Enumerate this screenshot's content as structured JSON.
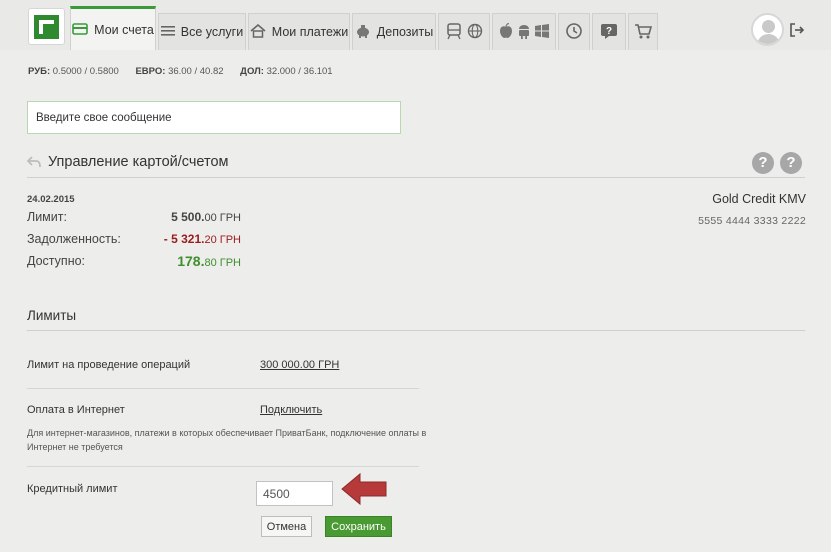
{
  "nav": {
    "tabs": [
      {
        "label": "Мои счета",
        "icon": "card-icon",
        "active": true
      },
      {
        "label": "Все услуги",
        "icon": "list-icon"
      },
      {
        "label": "Мои платежи",
        "icon": "home-icon"
      },
      {
        "label": "Депозиты",
        "icon": "piggy-bank-icon"
      }
    ],
    "icon_tabs": [
      "transport-icon",
      "globe-icon",
      "apple-icon",
      "android-icon",
      "windows-icon",
      "history-icon",
      "help-icon",
      "cart-icon"
    ]
  },
  "rates": {
    "rub_label": "РУБ:",
    "rub_value": "0.5000 / 0.5800",
    "eur_label": "ЕВРО:",
    "eur_value": "36.00 / 40.82",
    "usd_label": "ДОЛ:",
    "usd_value": "32.000 / 36.101"
  },
  "message": {
    "placeholder": "Введите свое сообщение"
  },
  "section": {
    "title": "Управление картой/счетом"
  },
  "account": {
    "date": "24.02.2015",
    "limit_label": "Лимит:",
    "limit_int": "5 500.",
    "limit_dec": "00 ГРН",
    "debt_label": "Задолженность:",
    "debt_int": "- 5 321.",
    "debt_dec": "20 ГРН",
    "available_label": "Доступно:",
    "available_int": "178.",
    "available_dec": "80 ГРН"
  },
  "card": {
    "name": "Gold Credit KMV",
    "number": "5555 4444 3333 2222"
  },
  "limits": {
    "title": "Лимиты",
    "ops_label": "Лимит на проведение операций",
    "ops_value": "300 000.00 ГРН",
    "internet_label": "Оплата в Интернет",
    "internet_link": "Подключить",
    "note": "Для интернет-магазинов, платежи в которых обеспечивает ПриватБанк, подключение оплаты в Интернет не требуется",
    "credit_label": "Кредитный лимит",
    "credit_value": "4500",
    "cancel": "Отмена",
    "save": "Сохранить"
  },
  "colors": {
    "accent": "#3a9a3a",
    "negative": "#9b1c1c",
    "positive": "#3f8f2e",
    "arrow": "#b73a3a"
  }
}
